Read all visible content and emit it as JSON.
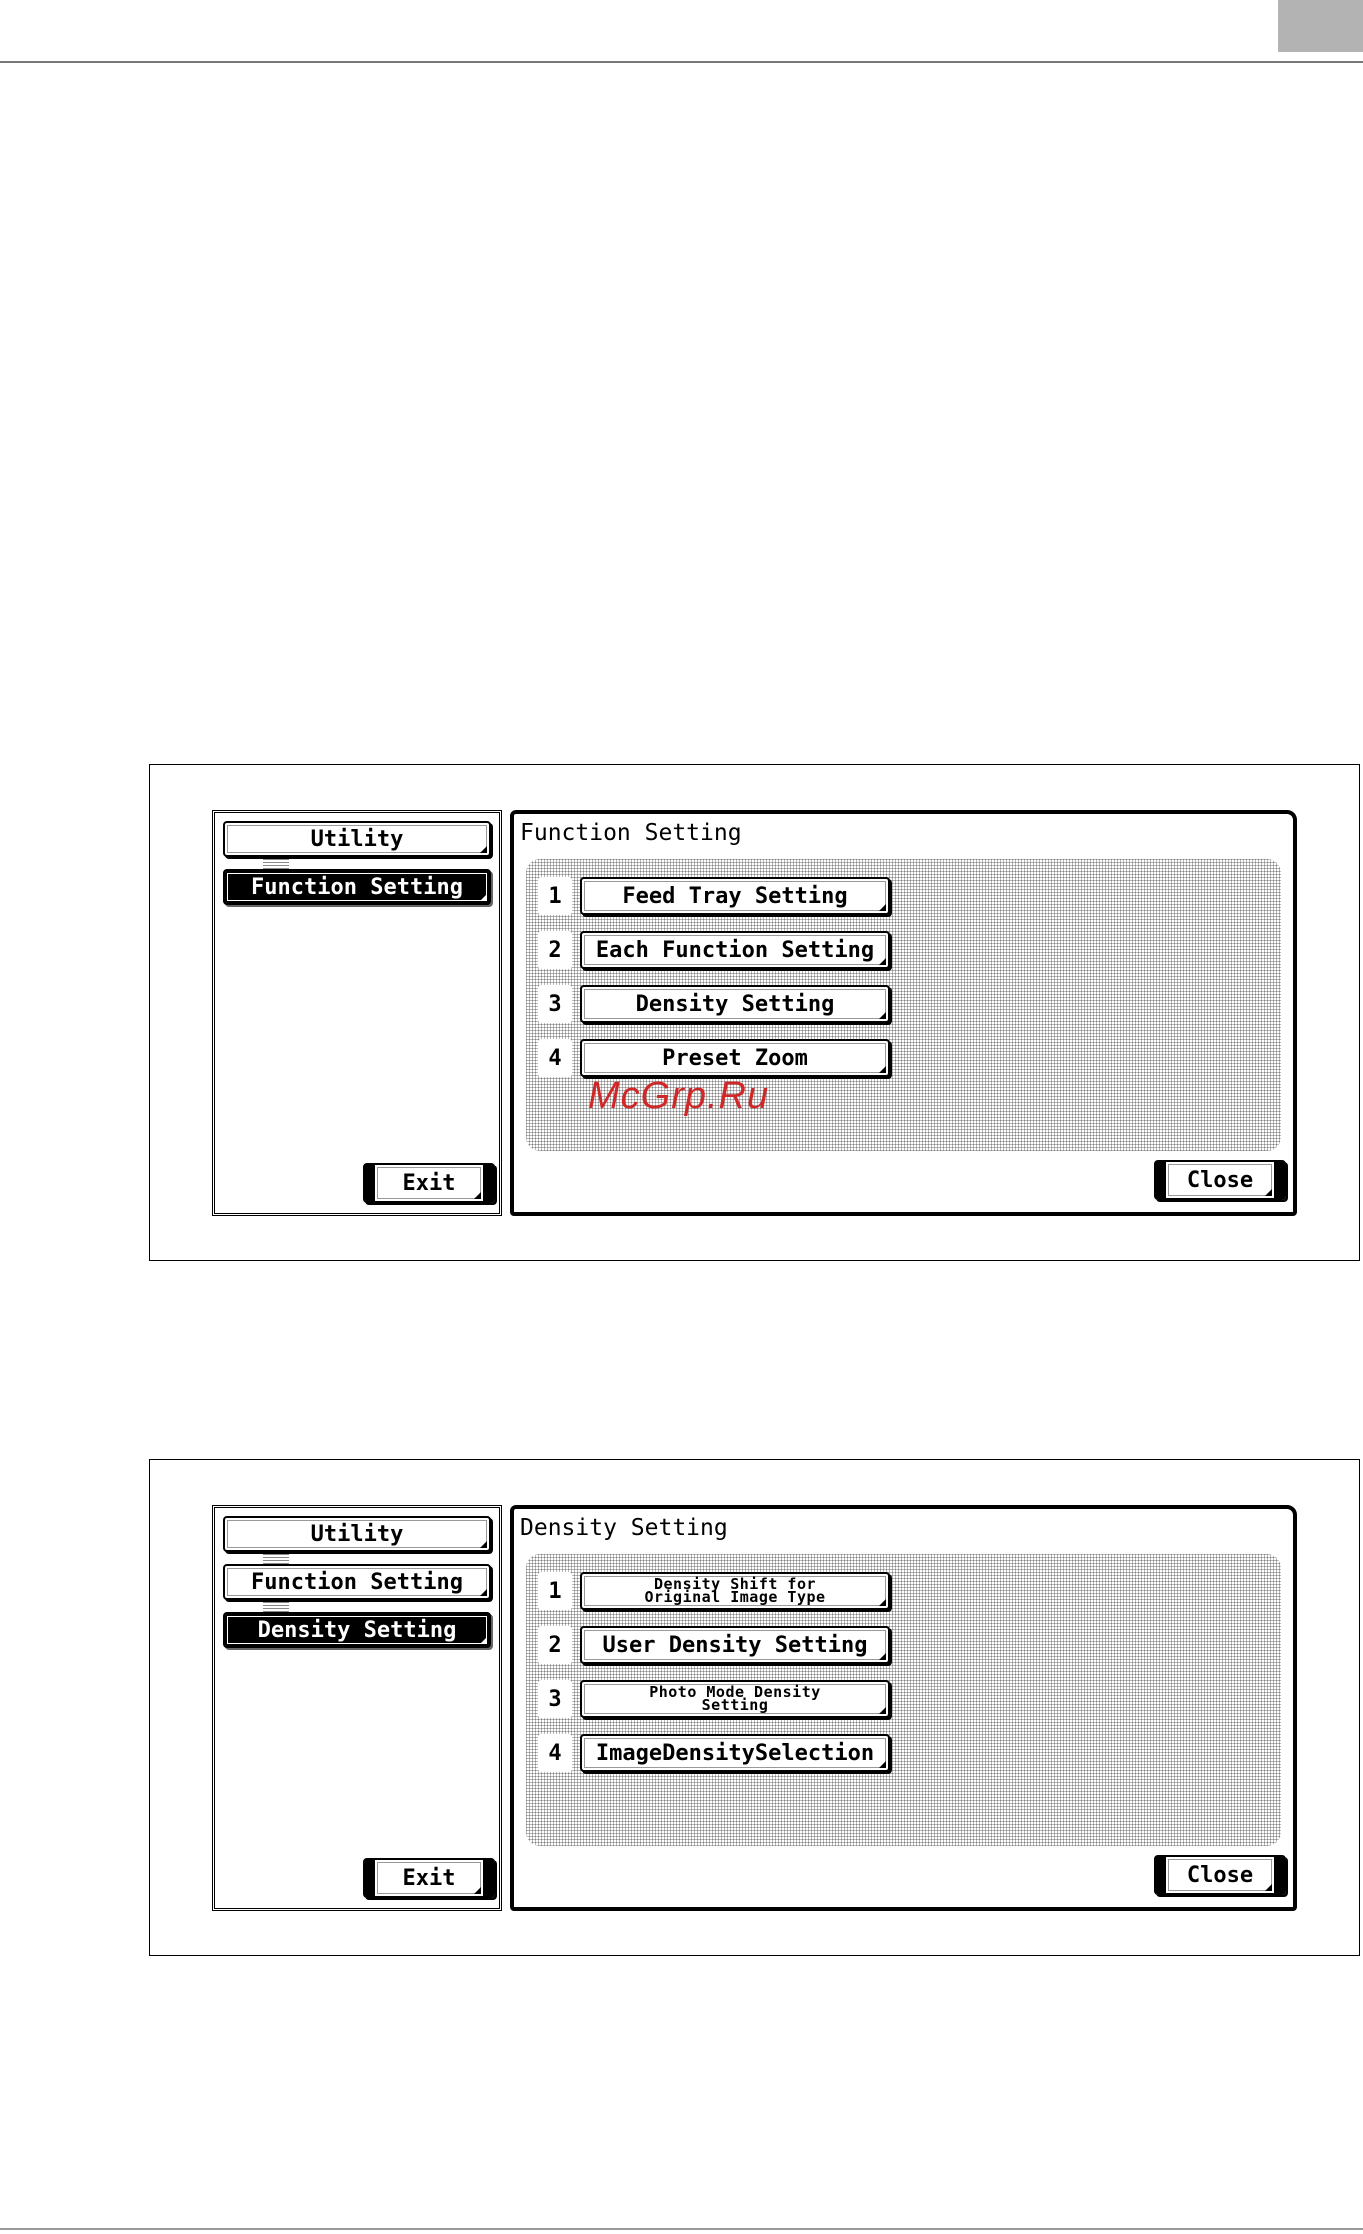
{
  "screen1": {
    "nav": {
      "utility": "Utility",
      "function_setting": "Function Setting",
      "exit": "Exit"
    },
    "title": "Function Setting",
    "items": [
      {
        "num": "1",
        "label": "Feed Tray Setting"
      },
      {
        "num": "2",
        "label": "Each Function Setting"
      },
      {
        "num": "3",
        "label": "Density Setting"
      },
      {
        "num": "4",
        "label": "Preset Zoom"
      }
    ],
    "watermark": "McGrp.Ru",
    "close": "Close"
  },
  "screen2": {
    "nav": {
      "utility": "Utility",
      "function_setting": "Function Setting",
      "density_setting": "Density Setting",
      "exit": "Exit"
    },
    "title": "Density Setting",
    "items": [
      {
        "num": "1",
        "label_line1": "Density Shift for",
        "label_line2": "Original Image Type"
      },
      {
        "num": "2",
        "label": "User Density Setting"
      },
      {
        "num": "3",
        "label_line1": "Photo Mode Density",
        "label_line2": "Setting"
      },
      {
        "num": "4",
        "label": "ImageDensitySelection"
      }
    ],
    "close": "Close"
  },
  "colors": {
    "watermark": "#d02828",
    "active_button": "#000000",
    "page_tab": "#b3b3b3"
  }
}
